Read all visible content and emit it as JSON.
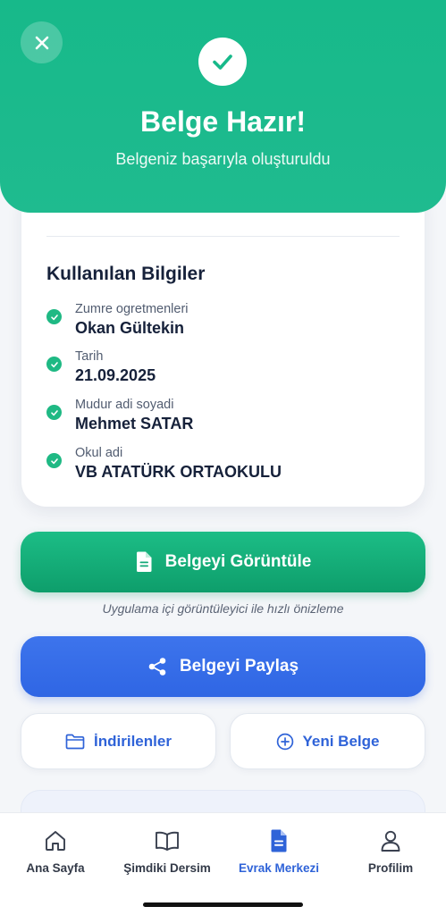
{
  "header": {
    "title": "Belge Hazır!",
    "subtitle": "Belgeniz başarıyla oluşturuldu"
  },
  "info_card": {
    "title": "Kullanılan Bilgiler",
    "items": [
      {
        "label": "Zumre ogretmenleri",
        "value": "Okan Gültekin"
      },
      {
        "label": "Tarih",
        "value": "21.09.2025"
      },
      {
        "label": "Mudur adi soyadi",
        "value": "Mehmet SATAR"
      },
      {
        "label": "Okul adi",
        "value": "VB ATATÜRK ORTAOKULU"
      }
    ]
  },
  "actions": {
    "view_label": "Belgeyi Görüntüle",
    "view_hint": "Uygulama içi görüntüleyici ile hızlı önizleme",
    "share_label": "Belgeyi Paylaş",
    "downloads_label": "İndirilenler",
    "new_label": "Yeni Belge"
  },
  "nav": {
    "items": [
      {
        "label": "Ana Sayfa",
        "icon": "home-icon"
      },
      {
        "label": "Şimdiki Dersim",
        "icon": "book-icon"
      },
      {
        "label": "Evrak Merkezi",
        "icon": "document-icon",
        "active": true
      },
      {
        "label": "Profilim",
        "icon": "user-icon"
      }
    ]
  },
  "colors": {
    "success": "#17b98a",
    "primary_blue": "#2f66e4",
    "nav_active": "#2f63d8"
  }
}
